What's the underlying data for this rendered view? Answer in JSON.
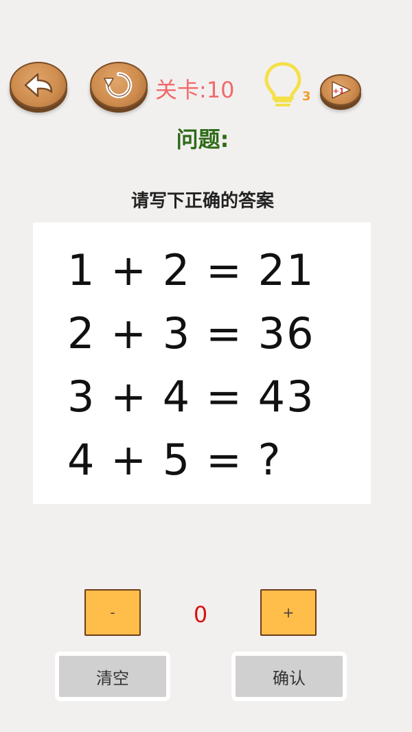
{
  "header": {
    "level_text": "关卡:10",
    "hint_count": "3",
    "video_reward_label": "+1"
  },
  "question": {
    "title": "问题:",
    "instruction": "请写下正确的答案",
    "equations": [
      "1 + 2 = 21",
      "2 + 3 = 36",
      "3 + 4 = 43",
      "4 + 5 = ?"
    ]
  },
  "answer": {
    "minus_label": "-",
    "plus_label": "+",
    "value": "0"
  },
  "actions": {
    "clear_label": "清空",
    "confirm_label": "确认"
  },
  "colors": {
    "level_text": "#f06a6a",
    "hint_count": "#f29b2c",
    "question_title": "#2f6b17",
    "answer_value": "#d61212",
    "step_button": "#ffbd4a",
    "action_button": "#d0d0d0",
    "wood": "#cf8d4f"
  },
  "icons": {
    "back": "back-arrow-icon",
    "restart": "restart-icon",
    "hint": "lightbulb-icon",
    "video": "video-play-icon"
  }
}
